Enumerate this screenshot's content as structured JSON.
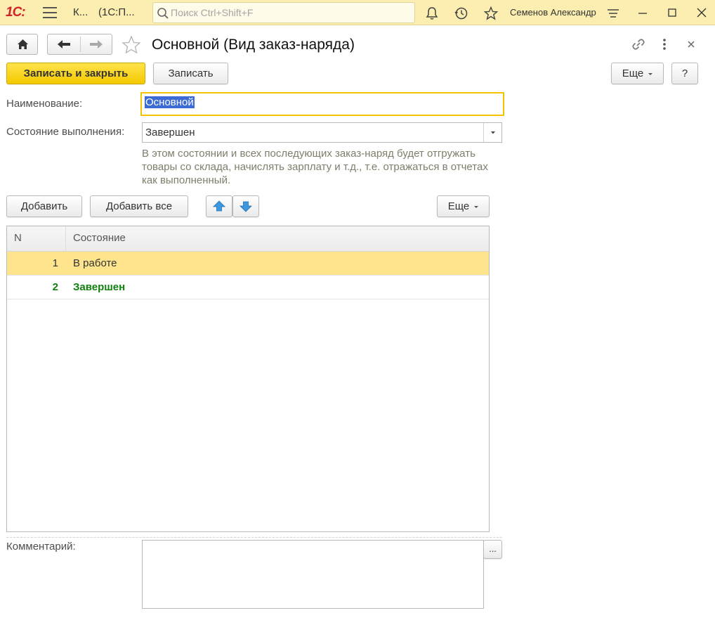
{
  "titlebar": {
    "logo": "1С:",
    "tab_short": "К...",
    "tab_app": "(1С:П...",
    "search_placeholder": "Поиск Ctrl+Shift+F",
    "user": "Семенов Александр"
  },
  "form": {
    "title": "Основной (Вид заказ-наряда)",
    "save_close": "Записать и закрыть",
    "save": "Записать",
    "more": "Еще",
    "help": "?"
  },
  "fields": {
    "name_label": "Наименование:",
    "name_value": "Основной",
    "state_label": "Состояние выполнения:",
    "state_value": "Завершен",
    "hint": "В этом состоянии и всех последующих заказ-наряд будет отгружать товары со склада, начислять зарплату и т.д., т.е. отражаться в отчетах как выполненный.",
    "comment_label": "Комментарий:",
    "comment_value": "",
    "comment_btn": "..."
  },
  "table_toolbar": {
    "add": "Добавить",
    "add_all": "Добавить все",
    "more": "Еще"
  },
  "table": {
    "columns": [
      "N",
      "Состояние"
    ],
    "rows": [
      {
        "n": "1",
        "state": "В работе"
      },
      {
        "n": "2",
        "state": "Завершен"
      }
    ]
  },
  "colors": {
    "titlebar_bg": "#fbeeb0",
    "primary_button": "#f4c900",
    "selected_row": "#fde48d",
    "completed_text": "#12800e"
  }
}
